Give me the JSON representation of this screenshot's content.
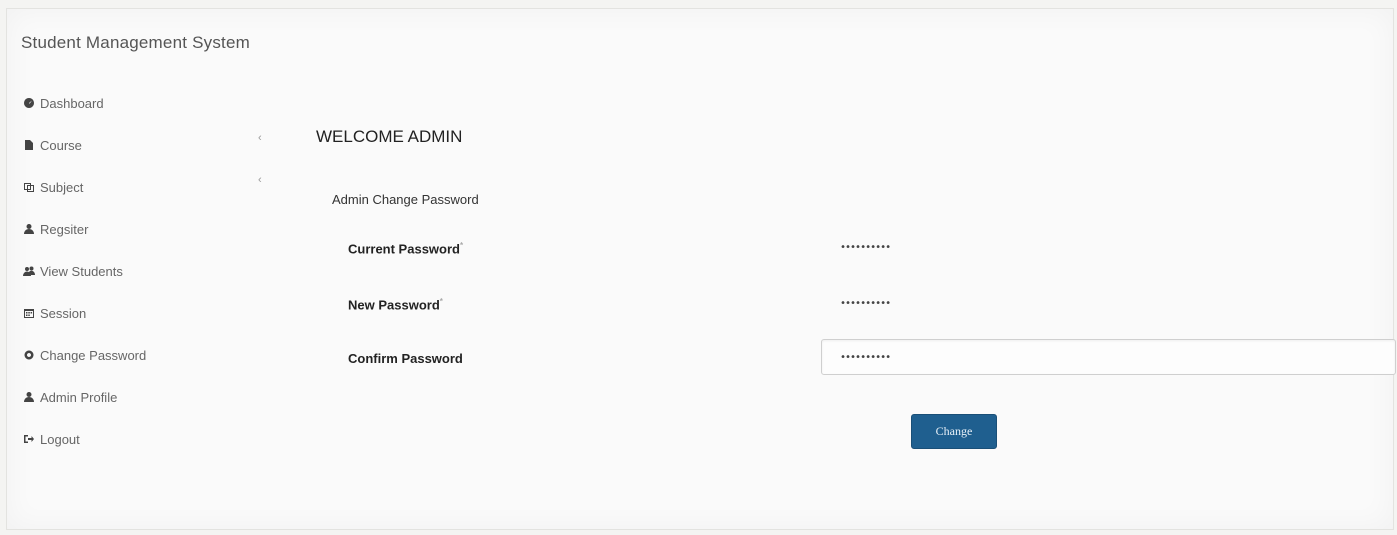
{
  "app": {
    "title": "Student Management System"
  },
  "sidebar": {
    "items": [
      {
        "label": "Dashboard",
        "icon": "dashboard-icon"
      },
      {
        "label": "Course",
        "icon": "course-icon",
        "caret": "‹"
      },
      {
        "label": "Subject",
        "icon": "subject-icon",
        "caret": "‹"
      },
      {
        "label": "Regsiter",
        "icon": "register-icon"
      },
      {
        "label": "View Students",
        "icon": "students-icon"
      },
      {
        "label": "Session",
        "icon": "calendar-icon"
      },
      {
        "label": "Change Password",
        "icon": "gear-icon"
      },
      {
        "label": "Admin Profile",
        "icon": "user-icon"
      },
      {
        "label": "Logout",
        "icon": "logout-icon"
      }
    ]
  },
  "main": {
    "welcome": "WELCOME ADMIN",
    "form_title": "Admin Change Password",
    "fields": {
      "current": {
        "label": "Current Password",
        "required_mark": "*",
        "value": "••••••••••"
      },
      "new": {
        "label": "New Password",
        "required_mark": "*",
        "value": "••••••••••"
      },
      "confirm": {
        "label": "Confirm Password",
        "value": "••••••••••"
      }
    },
    "submit_label": "Change"
  },
  "colors": {
    "button": "#1f5f8f",
    "background": "#fafafa"
  }
}
